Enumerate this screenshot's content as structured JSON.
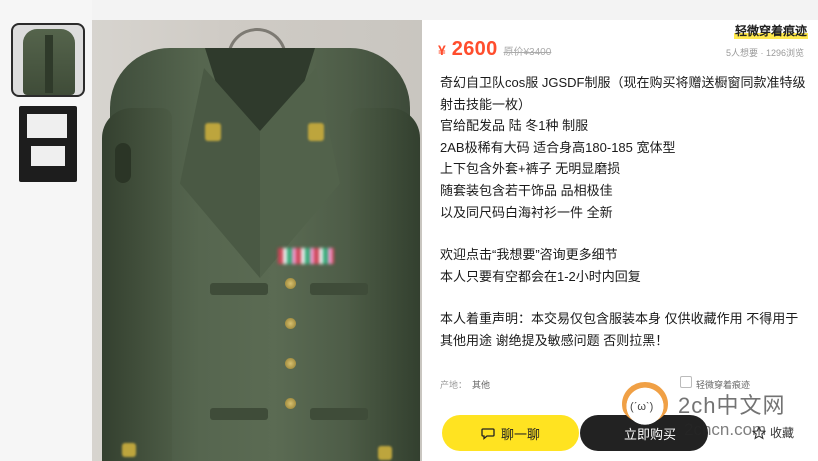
{
  "price": {
    "currency": "¥",
    "amount": "2600",
    "original": "原价¥3400"
  },
  "stats": "5人想要 · 1296浏览",
  "seller_tag": "轻微穿着痕迹",
  "description": [
    "奇幻自卫队cos服 JGSDF制服（现在购买将赠送橱窗同款准特级射击技能一枚）",
    "官给配发品 陆 冬1种 制服",
    "2AB极稀有大码 适合身高180-185 宽体型",
    "上下包含外套+裤子 无明显磨损",
    "随套装包含若干饰品 品相极佳",
    "以及同尺码白海衬衫一件 全新",
    "",
    "欢迎点击“我想要”咨询更多细节",
    "本人只要有空都会在1-2小时内回复",
    "",
    "本人着重声明：本交易仅包含服装本身 仅供收藏作用 不得用于其他用途 谢绝提及敏感问题 否则拉黑！"
  ],
  "meta": {
    "origin_label": "产地：",
    "origin_value": "其他",
    "condition_value": "轻微穿着痕迹"
  },
  "actions": {
    "chat": "聊一聊",
    "buy": "立即购买",
    "favorite": "收藏"
  },
  "watermark": {
    "face": "(ˊωˋ)",
    "site": "2ch中文网",
    "domain": "2chcn.com"
  },
  "icons": {
    "chat": "chat-bubble-icon",
    "favorite": "star-icon",
    "tag": "tag-icon"
  },
  "colors": {
    "price": "#ff4d2d",
    "chat_button": "#ffe321",
    "buy_button": "#222222"
  }
}
